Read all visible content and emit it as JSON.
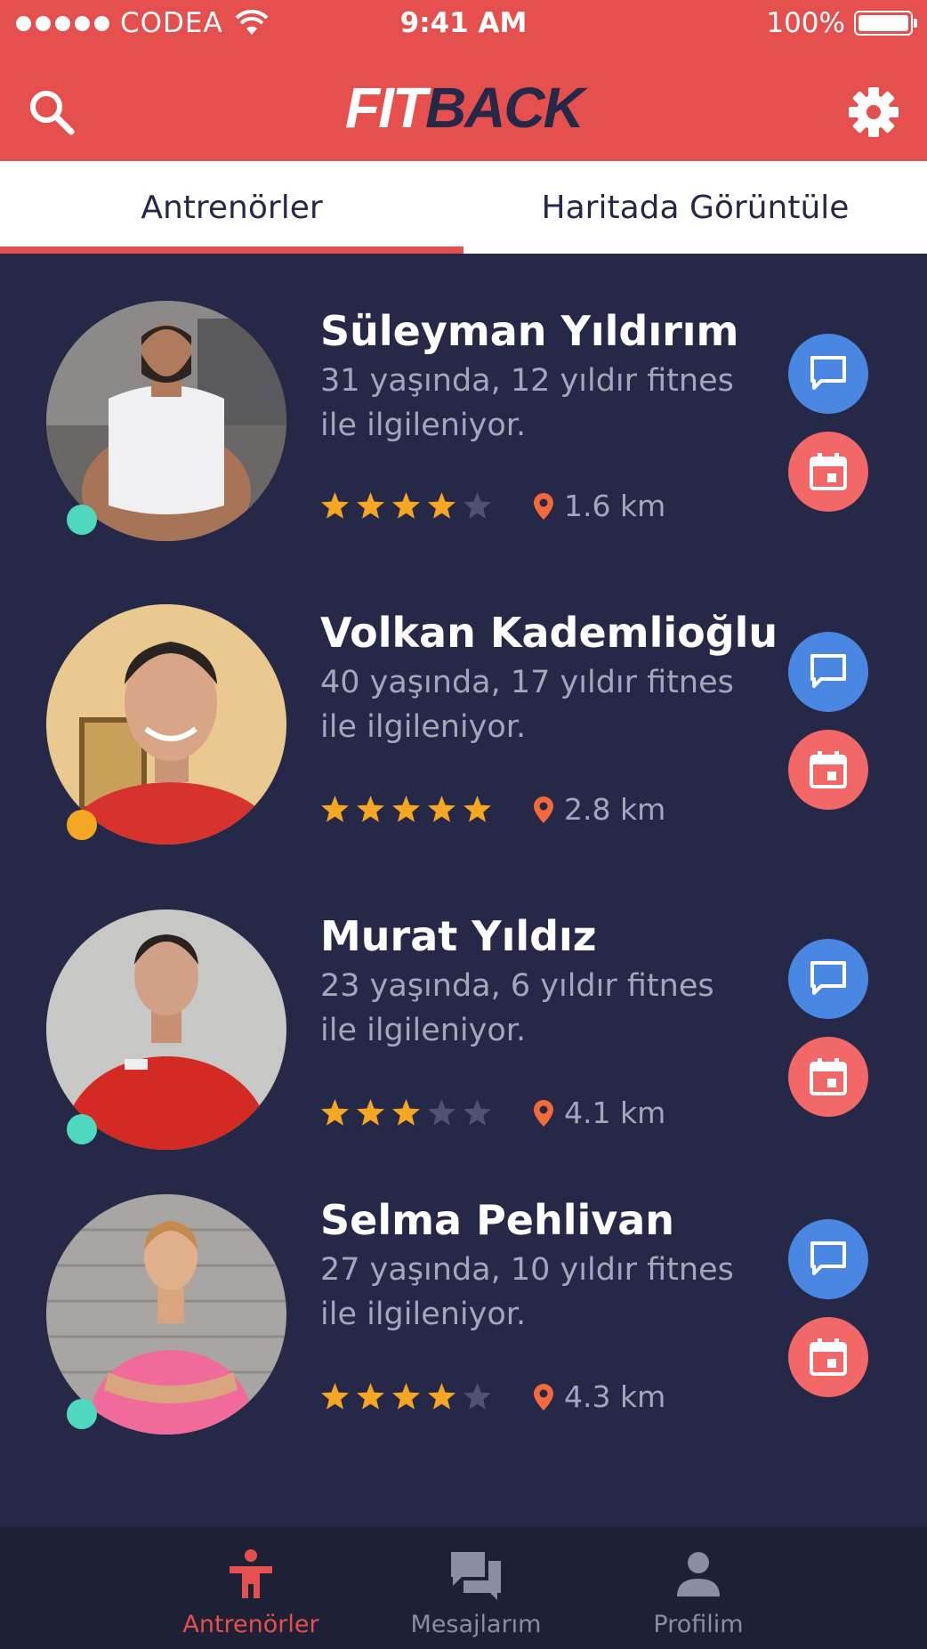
{
  "status_bar": {
    "carrier": "CODEA",
    "time": "9:41 AM",
    "battery": "100%"
  },
  "header": {
    "logo_part1": "FIT",
    "logo_part2": "BACK",
    "search_icon": "search-icon",
    "settings_icon": "gear-icon"
  },
  "tabs": [
    {
      "label": "Antrenörler",
      "active": true
    },
    {
      "label": "Haritada Görüntüle",
      "active": false
    }
  ],
  "trainers": [
    {
      "name": "Süleyman Yıldırım",
      "desc": "31 yaşında, 12 yıldır fitnes ile ilgileniyor.",
      "rating": 4,
      "distance": "1.6 km",
      "status_color": "#4fd8bd"
    },
    {
      "name": "Volkan Kademlioğlu",
      "desc": "40 yaşında, 17 yıldır fitnes ile ilgileniyor.",
      "rating": 5,
      "distance": "2.8 km",
      "status_color": "#f5a623"
    },
    {
      "name": "Murat Yıldız",
      "desc": "23 yaşında, 6 yıldır fitnes ile ilgileniyor.",
      "rating": 3,
      "distance": "4.1 km",
      "status_color": "#4fd8bd"
    },
    {
      "name": "Selma Pehlivan",
      "desc": "27 yaşında, 10 yıldır fitnes ile ilgileniyor.",
      "rating": 4,
      "distance": "4.3 km",
      "status_color": "#4fd8bd"
    }
  ],
  "bottom_nav": [
    {
      "label": "Antrenörler",
      "icon": "trainer-icon",
      "active": true
    },
    {
      "label": "Mesajlarım",
      "icon": "messages-icon",
      "active": false
    },
    {
      "label": "Profilim",
      "icon": "profile-icon",
      "active": false
    }
  ],
  "colors": {
    "primary": "#e5504e",
    "background": "#252846",
    "star_filled": "#f5a623",
    "star_empty": "#4f5270",
    "message_button": "#4a87e2",
    "calendar_button": "#f26767",
    "online": "#4fd8bd",
    "away": "#f5a623"
  }
}
